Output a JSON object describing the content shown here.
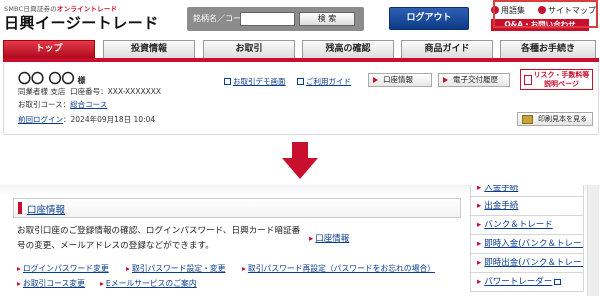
{
  "header": {
    "tagline_prefix": "SMBC日興証券の",
    "tagline_highlight": "オンライントレード",
    "logo": "日興イージートレード",
    "search_label": "銘柄名／コード",
    "search_value": "",
    "search_button": "検 索",
    "logout": "ログアウト",
    "glossary": "用語集",
    "sitemap": "サイトマップ",
    "qa": "Q&A・お問い合わせ"
  },
  "nav": {
    "tabs": [
      "トップ",
      "投資情報",
      "お取引",
      "残高の確認",
      "商品ガイド",
      "各種お手続き"
    ],
    "active_index": 0,
    "highlighted_index": 5
  },
  "account": {
    "name": "〇〇 〇〇",
    "honorific": "様",
    "branch": "同業者様 支店",
    "account_label": "口座番号：",
    "account_number": "XXX-XXXXXXX",
    "course_label": "お取引コース：",
    "course": "総合コース",
    "last_login_label": "前回ログイン",
    "last_login": "2024年09月18日 10:04",
    "demo_link": "お取引デモ画面",
    "guide_link": "ご利用ガイド",
    "account_info_btn": "口座情報",
    "edelivery_btn": "電子交付履歴",
    "risk_btn_line1": "リスク・手数料等",
    "risk_btn_line2": "説明ページ",
    "print_btn": "印刷見本を見る"
  },
  "section": {
    "title": "口座情報",
    "description": "お取引口座のご登録情報の確認、ログインパスワード、日興カード暗証番号の変更、メールアドレスの登録などができます。",
    "side_link": "口座情報",
    "links_row1": [
      "ログインパスワード変更",
      "取引パスワード設定・変更",
      "取引パスワード再設定（パスワードをお忘れの場合）"
    ],
    "links_row2": [
      "お取引コース変更",
      "Eメールサービスのご案内"
    ]
  },
  "right_menu": {
    "items": [
      "入金手続",
      "出金手続",
      "バンク＆トレード",
      "即時入金(バンク＆トレード)",
      "即時出金(バンク＆トレード)",
      "パワートレーダー"
    ]
  },
  "colors": {
    "brand_red": "#c8102e",
    "logout_blue": "#0c3b87",
    "link_blue": "#0a3d91"
  }
}
